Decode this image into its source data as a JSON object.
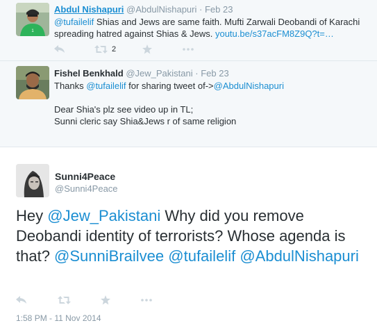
{
  "replies": [
    {
      "name": "Abdul Nishapuri",
      "handle": "@AbdulNishapuri",
      "separator": "·",
      "date": "Feb 23",
      "line1": [
        {
          "text": "@tufailelif",
          "link": true
        },
        {
          "text": " Shias and Jews are same faith. Mufti Zarwali Deobandi of Karachi",
          "link": false
        }
      ],
      "line2": [
        {
          "text": "spreading hatred against Shias & Jews. ",
          "link": false
        },
        {
          "text": "youtu.be/s37acFM8Z9Q?t=…",
          "link": true
        }
      ],
      "retweet_count": "2"
    },
    {
      "name": "Fishel Benkhald",
      "handle": "@Jew_Pakistani",
      "separator": "·",
      "date": "Feb 23",
      "line1": [
        {
          "text": "Thanks ",
          "link": false
        },
        {
          "text": "@tufailelif",
          "link": true
        },
        {
          "text": " for sharing tweet of->",
          "link": false
        },
        {
          "text": "@AbdulNishapuri",
          "link": true
        }
      ],
      "line2": "Dear Shia's plz see video up in TL;",
      "line3": "Sunni cleric say Shia&Jews r of same religion"
    }
  ],
  "main_tweet": {
    "name": "Sunni4Peace",
    "handle": "@Sunni4Peace",
    "text_parts": [
      {
        "text": "Hey ",
        "link": false
      },
      {
        "text": "@Jew_Pakistani",
        "link": true
      },
      {
        "text": " Why did you remove Deobandi identity of terrorists? Whose agenda is that? ",
        "link": false
      },
      {
        "text": "@SunniBrailvee",
        "link": true
      },
      {
        "text": " ",
        "link": false
      },
      {
        "text": "@tufailelif",
        "link": true
      },
      {
        "text": " ",
        "link": false
      },
      {
        "text": "@AbdulNishapuri",
        "link": true
      }
    ],
    "timestamp": "1:58 PM - 11 Nov 2014"
  },
  "icons": {
    "reply": "reply-arrow-icon",
    "retweet": "retweet-icon",
    "favorite": "star-icon",
    "more": "more-dots-icon"
  },
  "colors": {
    "link": "#1b8ed2",
    "muted": "#8899a6",
    "text": "#292f33",
    "icon": "#ccd6dd",
    "reply_bg": "#f5f8fa"
  }
}
